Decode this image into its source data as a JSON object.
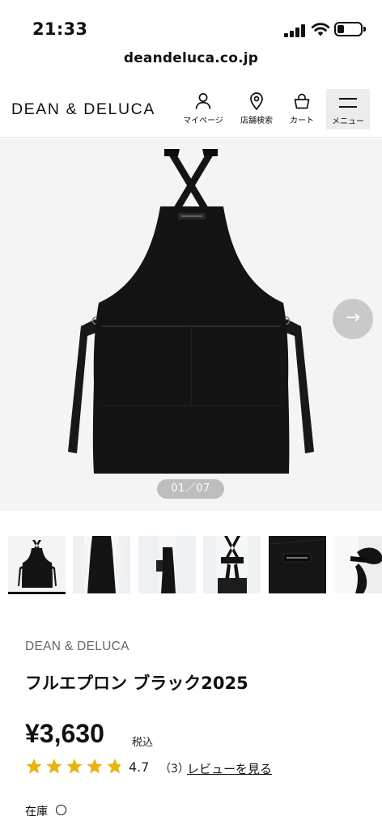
{
  "status_bar": {
    "time": "21:33"
  },
  "browser": {
    "url": "deandeluca.co.jp"
  },
  "header": {
    "logo": "DEAN & DELUCA",
    "mypage_label": "マイページ",
    "store_search_label": "店舗検索",
    "cart_label": "カート",
    "menu_label": "メニュー"
  },
  "gallery": {
    "counter": "01／07",
    "next_icon": "arrow-right-icon",
    "apron_tag_text": "DEAN & DELUCA",
    "thumbnail_count": 7,
    "selected_thumbnail": 1
  },
  "product": {
    "brand": "DEAN & DELUCA",
    "name": "フルエプロン ブラック2025",
    "price": "¥3,630",
    "tax_label": "税込",
    "rating_value": "4.7",
    "rating_stars": 4.7,
    "review_count": "（3）",
    "review_link": "レビューを見る",
    "stock_label": "在庫",
    "stock_mark": "○"
  },
  "colors": {
    "star": "#e8b30e",
    "star_empty": "#dddddd",
    "apron": "#141414",
    "gallery_bg": "#f4f4f4"
  }
}
